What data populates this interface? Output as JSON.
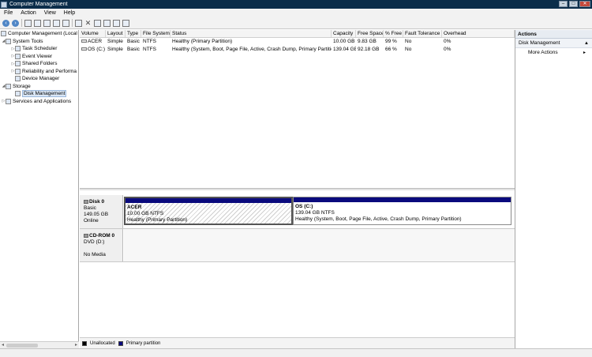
{
  "window": {
    "title": "Computer Management"
  },
  "window_controls": {
    "minimize": "–",
    "maximize": "□",
    "close": "✕"
  },
  "menu": [
    "File",
    "Action",
    "View",
    "Help"
  ],
  "toolbar_icons": [
    "back-icon",
    "forward-icon",
    "up-folder-icon",
    "show-hide-tree-icon",
    "help-icon",
    "show-hide-action-pane-icon",
    "check-icon",
    "delete-icon",
    "properties-icon",
    "export-icon",
    "new-window-icon",
    "refresh-icon"
  ],
  "tree": {
    "items": [
      {
        "label": "Computer Management (Local",
        "level": 0,
        "expander": ""
      },
      {
        "label": "System Tools",
        "level": 1,
        "expander": "◢"
      },
      {
        "label": "Task Scheduler",
        "level": 2,
        "expander": "▷"
      },
      {
        "label": "Event Viewer",
        "level": 2,
        "expander": "▷"
      },
      {
        "label": "Shared Folders",
        "level": 2,
        "expander": "▷"
      },
      {
        "label": "Reliability and Performa",
        "level": 2,
        "expander": "▷"
      },
      {
        "label": "Device Manager",
        "level": 2,
        "expander": ""
      },
      {
        "label": "Storage",
        "level": 1,
        "expander": "◢"
      },
      {
        "label": "Disk Management",
        "level": 2,
        "expander": "",
        "selected": true
      },
      {
        "label": "Services and Applications",
        "level": 1,
        "expander": "▷"
      }
    ]
  },
  "volume_table": {
    "columns": [
      "Volume",
      "Layout",
      "Type",
      "File System",
      "Status",
      "Capacity",
      "Free Space",
      "% Free",
      "Fault Tolerance",
      "Overhead"
    ],
    "rows": [
      [
        "ACER",
        "Simple",
        "Basic",
        "NTFS",
        "Healthy (Primary Partition)",
        "10.00 GB",
        "9.83 GB",
        "99 %",
        "No",
        "0%"
      ],
      [
        "OS (C:)",
        "Simple",
        "Basic",
        "NTFS",
        "Healthy (System, Boot, Page File, Active, Crash Dump, Primary Partition)",
        "139.04 GB",
        "92.18 GB",
        "66 %",
        "No",
        "0%"
      ]
    ]
  },
  "disks": {
    "disk0": {
      "name": "Disk 0",
      "type": "Basic",
      "size": "149.05 GB",
      "status": "Online",
      "partitions": [
        {
          "name": "ACER",
          "size": "10.00 GB NTFS",
          "status": "Healthy (Primary Partition)"
        },
        {
          "name": "OS  (C:)",
          "size": "139.04 GB NTFS",
          "status": "Healthy (System, Boot, Page File, Active, Crash Dump, Primary Partition)"
        }
      ]
    },
    "cdrom0": {
      "name": "CD-ROM 0",
      "type": "DVD (D:)",
      "status": "No Media"
    }
  },
  "legend": {
    "items": [
      {
        "label": "Unallocated",
        "color": "#000000"
      },
      {
        "label": "Primary partition",
        "color": "#0a0a7d"
      }
    ]
  },
  "actions": {
    "header": "Actions",
    "section": "Disk Management",
    "items": [
      "More Actions"
    ]
  }
}
